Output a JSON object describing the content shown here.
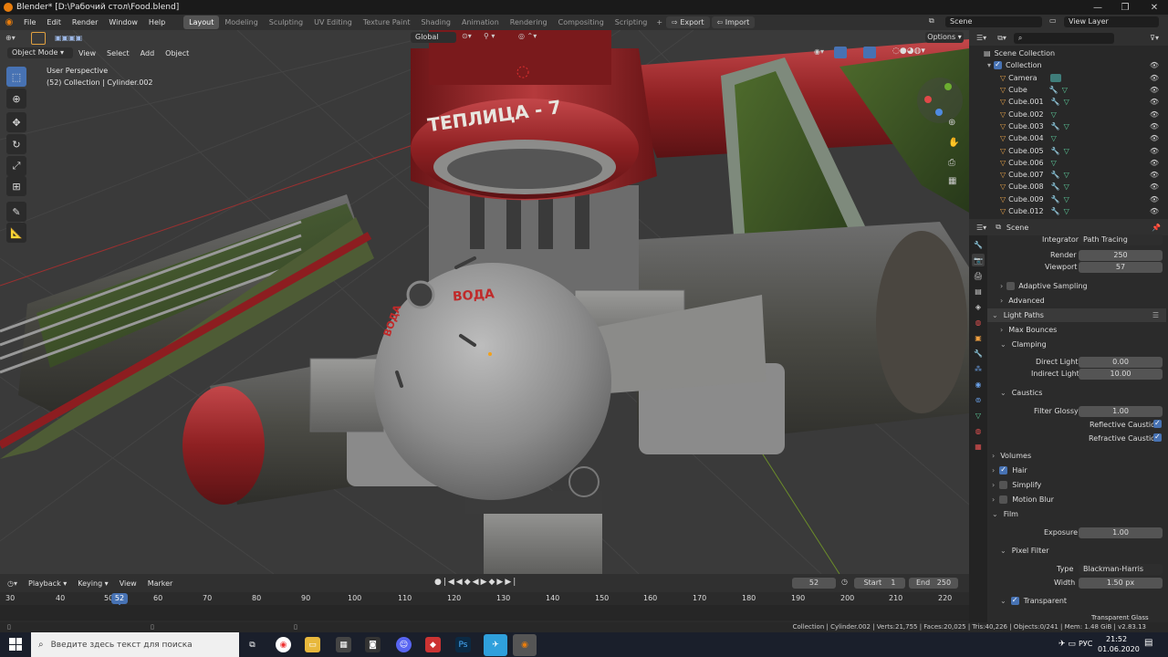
{
  "window": {
    "title": "Blender* [D:\\Рабочий стол\\Food.blend]",
    "min": "—",
    "max": "❐",
    "close": "✕"
  },
  "menu": [
    "File",
    "Edit",
    "Render",
    "Window",
    "Help"
  ],
  "workspaces": [
    "Layout",
    "Modeling",
    "Sculpting",
    "UV Editing",
    "Texture Paint",
    "Shading",
    "Animation",
    "Rendering",
    "Compositing",
    "Scripting"
  ],
  "active_workspace": "Layout",
  "export_label": "Export",
  "import_label": "Import",
  "scene_name": "Scene",
  "view_layer": "View Layer",
  "viewport": {
    "mode": "Object Mode",
    "menus": [
      "View",
      "Select",
      "Add",
      "Object"
    ],
    "transform_orientation": "Global",
    "options_label": "Options",
    "overlay_line1": "User Perspective",
    "overlay_line2": "(52) Collection | Cylinder.002",
    "label_teplitsa": "ТЕПЛИЦА - 7",
    "label_voda": "ВОДА",
    "label_voda_side": "ВОДА"
  },
  "outliner": {
    "root": "Scene Collection",
    "collection": "Collection",
    "items": [
      "Camera",
      "Cube",
      "Cube.001",
      "Cube.002",
      "Cube.003",
      "Cube.004",
      "Cube.005",
      "Cube.006",
      "Cube.007",
      "Cube.008",
      "Cube.009",
      "Cube.012"
    ]
  },
  "properties": {
    "header": "Scene",
    "integrator_label": "Integrator",
    "integrator_value": "Path Tracing",
    "render_label": "Render",
    "render_value": "250",
    "viewport_label": "Viewport",
    "viewport_value": "57",
    "adaptive_sampling": "Adaptive Sampling",
    "advanced": "Advanced",
    "light_paths": "Light Paths",
    "max_bounces": "Max Bounces",
    "clamping": "Clamping",
    "direct_light_label": "Direct Light",
    "direct_light_value": "0.00",
    "indirect_light_label": "Indirect Light",
    "indirect_light_value": "10.00",
    "caustics": "Caustics",
    "filter_glossy_label": "Filter Glossy",
    "filter_glossy_value": "1.00",
    "reflective_caustics": "Reflective Caustics",
    "refractive_caustics": "Refractive Caustics",
    "volumes": "Volumes",
    "hair": "Hair",
    "simplify": "Simplify",
    "motion_blur": "Motion Blur",
    "film": "Film",
    "exposure_label": "Exposure",
    "exposure_value": "1.00",
    "pixel_filter": "Pixel Filter",
    "type_label": "Type",
    "type_value": "Blackman-Harris",
    "width_label": "Width",
    "width_value": "1.50 px",
    "transparent": "Transparent",
    "transparent_glass": "Transparent Glass"
  },
  "timeline": {
    "menus": [
      "Playback",
      "Keying",
      "View",
      "Marker"
    ],
    "current_frame": "52",
    "start_label": "Start",
    "start_value": "1",
    "end_label": "End",
    "end_value": "250",
    "ticks": [
      "30",
      "40",
      "50",
      "60",
      "70",
      "80",
      "90",
      "100",
      "110",
      "120",
      "130",
      "140",
      "150",
      "160",
      "170",
      "180",
      "190",
      "200",
      "210",
      "220"
    ]
  },
  "status_bar": "Collection | Cylinder.002 | Verts:21,755 | Faces:20,025 | Tris:40,226 | Objects:0/241 | Mem: 1.48 GiB | v2.83.13",
  "taskbar": {
    "search_placeholder": "Введите здесь текст для поиска",
    "lang": "РУС",
    "time": "21:52",
    "date": "01.06.2020"
  }
}
